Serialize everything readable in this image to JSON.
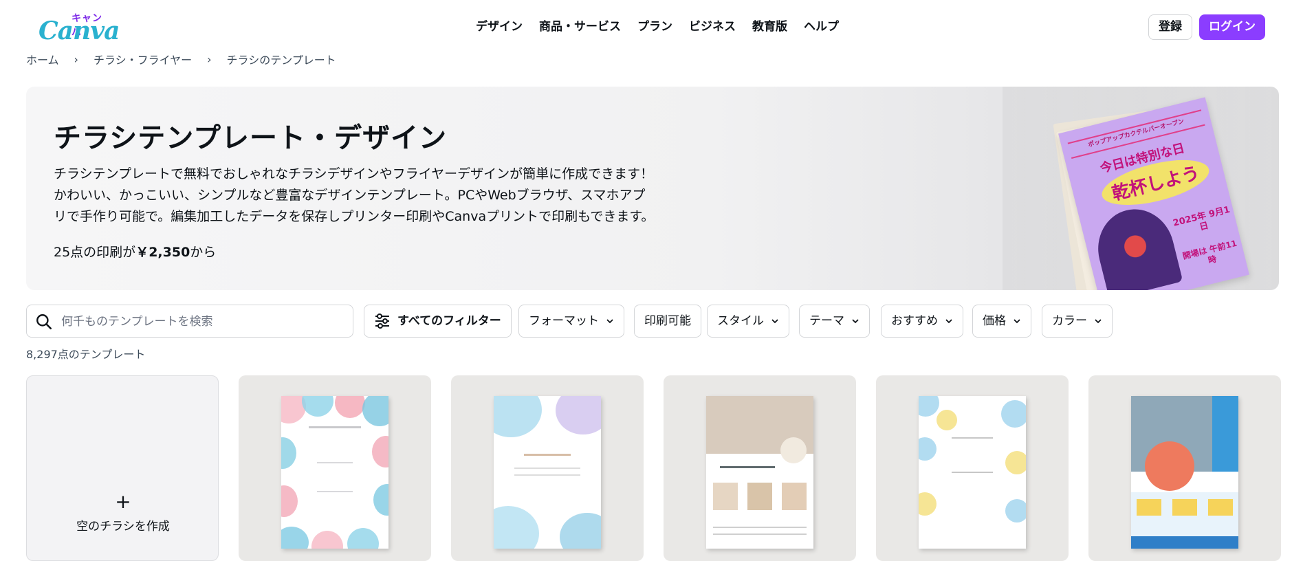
{
  "header": {
    "logo": {
      "kana": "キャンバ",
      "word": "Canva"
    },
    "nav": [
      "デザイン",
      "商品・サービス",
      "プラン",
      "ビジネス",
      "教育版",
      "ヘルプ"
    ],
    "register_label": "登録",
    "login_label": "ログイン"
  },
  "breadcrumb": [
    "ホーム",
    "チラシ・フライヤー",
    "チラシのテンプレート"
  ],
  "hero": {
    "title": "チラシテンプレート・デザイン",
    "description_lines": [
      "チラシテンプレートで無料でおしゃれなチラシデザインやフライヤーデザインが簡単に作成できます！",
      "かわいい、かっこいい、シンプルなど豊富なデザインテンプレート。PCやWebブラウザ、スマホアプ",
      "リで手作り可能で。編集加工したデータを保存しプリンター印刷やCanvaプリントで印刷もできます。"
    ],
    "price_prefix": "25点の印刷が",
    "price_value": "￥2,350",
    "price_suffix": "から",
    "flyer": {
      "banner": "ポップアップカクテルバーオープン",
      "line1": "今日は特別な日",
      "line2": "乾杯しよう",
      "date": "2025年 9月1日",
      "time": "開場は 午前11時"
    }
  },
  "search": {
    "placeholder": "何千ものテンプレートを検索"
  },
  "filters": {
    "all": "すべてのフィルター",
    "format": "フォーマット",
    "printable": "印刷可能",
    "style": "スタイル",
    "theme": "テーマ",
    "recommended": "おすすめ",
    "price": "価格",
    "color": "カラー"
  },
  "result_count": "8,297点のテンプレート",
  "cards": {
    "blank_label": "空のチラシを作成",
    "blank_plus": "+"
  },
  "colors": {
    "accent": "#8b3dff",
    "text": "#0e1318"
  }
}
